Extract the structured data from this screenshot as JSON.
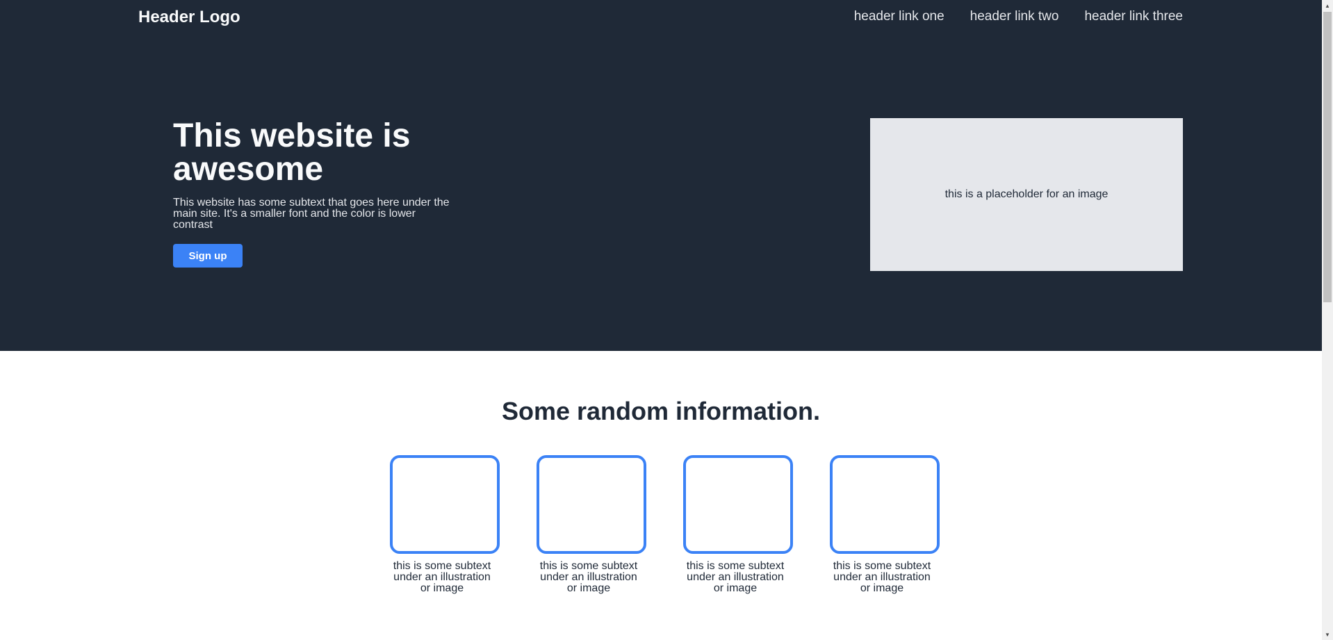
{
  "header": {
    "logo": "Header Logo",
    "links": [
      "header link one",
      "header link two",
      "header link three"
    ]
  },
  "hero": {
    "title": "This website is awesome",
    "subtext": "This website has some subtext that goes here under the main site. It's a smaller font and the color is lower contrast",
    "button_label": "Sign up",
    "image_placeholder": "this is a placeholder for an image"
  },
  "info": {
    "title": "Some random information.",
    "cards": [
      {
        "text": "this is some subtext under an illustration or image"
      },
      {
        "text": "this is some subtext under an illustration or image"
      },
      {
        "text": "this is some subtext under an illustration or image"
      },
      {
        "text": "this is some subtext under an illustration or image"
      }
    ]
  },
  "colors": {
    "dark_bg": "#1f2937",
    "accent": "#3b82f6",
    "placeholder_bg": "#e5e7eb"
  },
  "scrollbar": {
    "up_icon": "scroll-up-arrow-icon",
    "down_icon": "scroll-down-arrow-icon"
  }
}
